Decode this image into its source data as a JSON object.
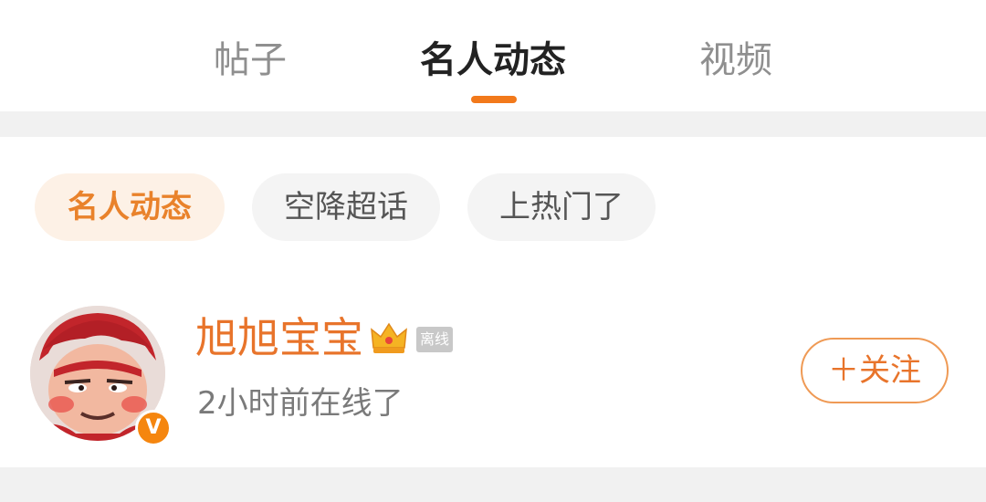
{
  "tabs": [
    {
      "label": "帖子",
      "active": false
    },
    {
      "label": "名人动态",
      "active": true
    },
    {
      "label": "视频",
      "active": false
    }
  ],
  "filters": [
    {
      "label": "名人动态",
      "active": true
    },
    {
      "label": "空降超话",
      "active": false
    },
    {
      "label": "上热门了",
      "active": false
    }
  ],
  "user": {
    "name": "旭旭宝宝",
    "badge": "离线",
    "status": "2小时前在线了",
    "verified_mark": "V",
    "avatar_icon": "cartoon-avatar",
    "crown_icon": "crown-icon"
  },
  "follow": {
    "label": "＋关注"
  },
  "colors": {
    "accent": "#f2791b",
    "name": "#e8742b",
    "gray_text": "#7a7a7a"
  }
}
